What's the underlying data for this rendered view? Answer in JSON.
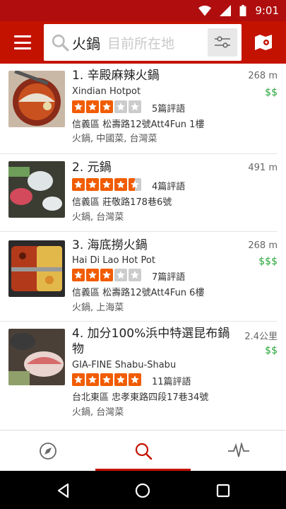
{
  "status": {
    "time": "9:01"
  },
  "search": {
    "query": "火鍋",
    "location_placeholder": "目前所在地"
  },
  "colors": {
    "brand": "#c41200",
    "star": "#f15c00",
    "star_empty": "#cccccc",
    "price": "#2aa63a"
  },
  "results": [
    {
      "title": "1. 辛殿麻辣火鍋",
      "subtitle": "Xindian Hotpot",
      "rating": 3,
      "reviews": "5篇評語",
      "address": "信義區 松壽路12號Att4Fun 1樓",
      "categories": "火鍋, 中國菜, 台灣菜",
      "distance": "268 m",
      "price": "$$"
    },
    {
      "title": "2. 元鍋",
      "subtitle": "",
      "rating": 4.5,
      "reviews": "4篇評語",
      "address": "信義區 莊敬路178巷6號",
      "categories": "火鍋, 台灣菜",
      "distance": "491 m",
      "price": ""
    },
    {
      "title": "3. 海底撈火鍋",
      "subtitle": "Hai Di Lao Hot Pot",
      "rating": 3,
      "reviews": "7篇評語",
      "address": "信義區 松壽路12號Att4Fun 6樓",
      "categories": "火鍋, 上海菜",
      "distance": "268 m",
      "price": "$$$"
    },
    {
      "title": "4. 加分100%浜中特選昆布鍋",
      "title_line2": "物",
      "subtitle": "GIA-FINE Shabu-Shabu",
      "rating": 5,
      "reviews": "11篇評語",
      "address": "台北東區 忠孝東路四段17巷34號",
      "categories": "火鍋, 台灣菜",
      "distance": "2.4公里",
      "price": "$$"
    }
  ],
  "tabs": [
    {
      "icon": "navigation-arrow-icon"
    },
    {
      "icon": "search-icon",
      "active": true
    },
    {
      "icon": "activity-icon"
    }
  ]
}
